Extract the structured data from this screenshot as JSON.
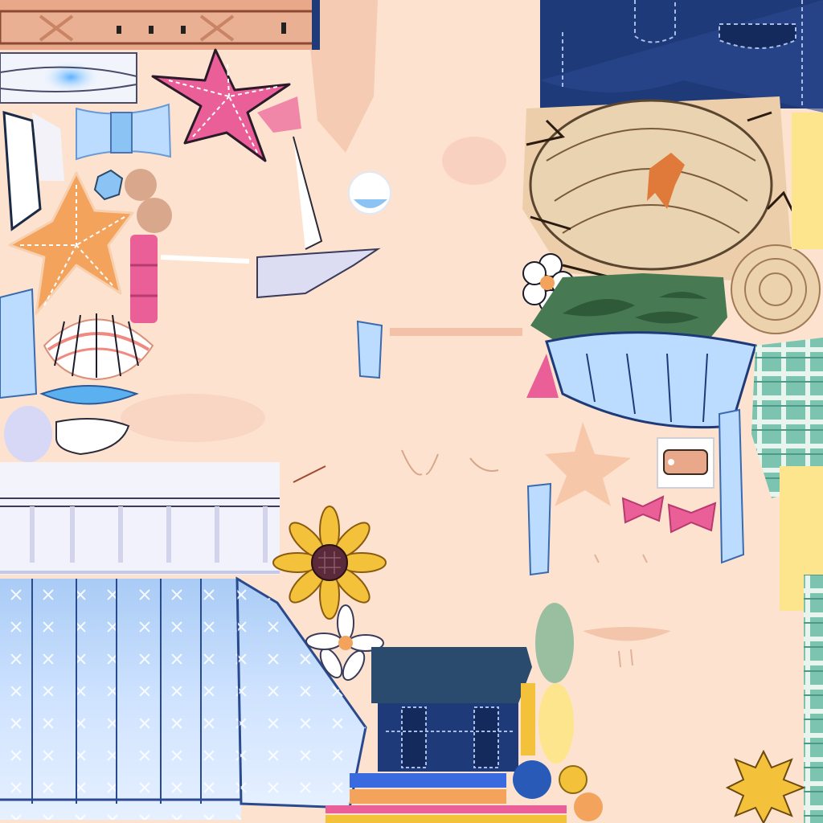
{
  "atlas": {
    "background_color": "#fde3cf",
    "palette": {
      "skin": "#fde3cf",
      "skin_shadow": "#f3c6ab",
      "denim": "#1f3a78",
      "denim_dark": "#152a5c",
      "light_blue": "#bcdcff",
      "sky_blue": "#8cc3f5",
      "pink": "#ea5f97",
      "orange": "#f4a35c",
      "straw": "#e9d3b0",
      "leaf_green": "#477a52",
      "plaid_green": "#7cc3b0",
      "sunflower": "#f4c13a",
      "yellow": "#fde58e",
      "belt_tan": "#e9a88a"
    },
    "parts": [
      {
        "name": "belt-strip",
        "icon": "belt-icon"
      },
      {
        "name": "denim-shorts-back",
        "icon": "denim-icon"
      },
      {
        "name": "blue-hair-ribbon",
        "icon": "ribbon-icon"
      },
      {
        "name": "pink-starfish",
        "icon": "starfish-icon"
      },
      {
        "name": "orange-starfish",
        "icon": "starfish-icon"
      },
      {
        "name": "seashell",
        "icon": "shell-icon"
      },
      {
        "name": "straw-hat-top",
        "icon": "straw-hat-icon"
      },
      {
        "name": "straw-hat-brim-coil",
        "icon": "straw-coil-icon"
      },
      {
        "name": "white-flower-small",
        "icon": "flower-icon"
      },
      {
        "name": "green-leaf-band",
        "icon": "leaf-icon"
      },
      {
        "name": "blue-ruffle",
        "icon": "ruffle-icon"
      },
      {
        "name": "green-plaid-fabric",
        "icon": "plaid-icon"
      },
      {
        "name": "sunflower",
        "icon": "sunflower-icon"
      },
      {
        "name": "white-flower-large",
        "icon": "flower-icon"
      },
      {
        "name": "blue-skirt-panel",
        "icon": "skirt-icon"
      },
      {
        "name": "white-lace-band",
        "icon": "lace-icon"
      },
      {
        "name": "denim-pocket-block",
        "icon": "pocket-icon"
      },
      {
        "name": "color-stripes",
        "icon": "stripes-icon"
      },
      {
        "name": "buckle",
        "icon": "buckle-icon"
      },
      {
        "name": "pink-bows",
        "icon": "bow-icon"
      },
      {
        "name": "skin-starfish-mark",
        "icon": "starfish-icon"
      },
      {
        "name": "gold-sun-badge",
        "icon": "sun-icon"
      },
      {
        "name": "face-skin-region",
        "icon": "face-icon"
      }
    ]
  }
}
